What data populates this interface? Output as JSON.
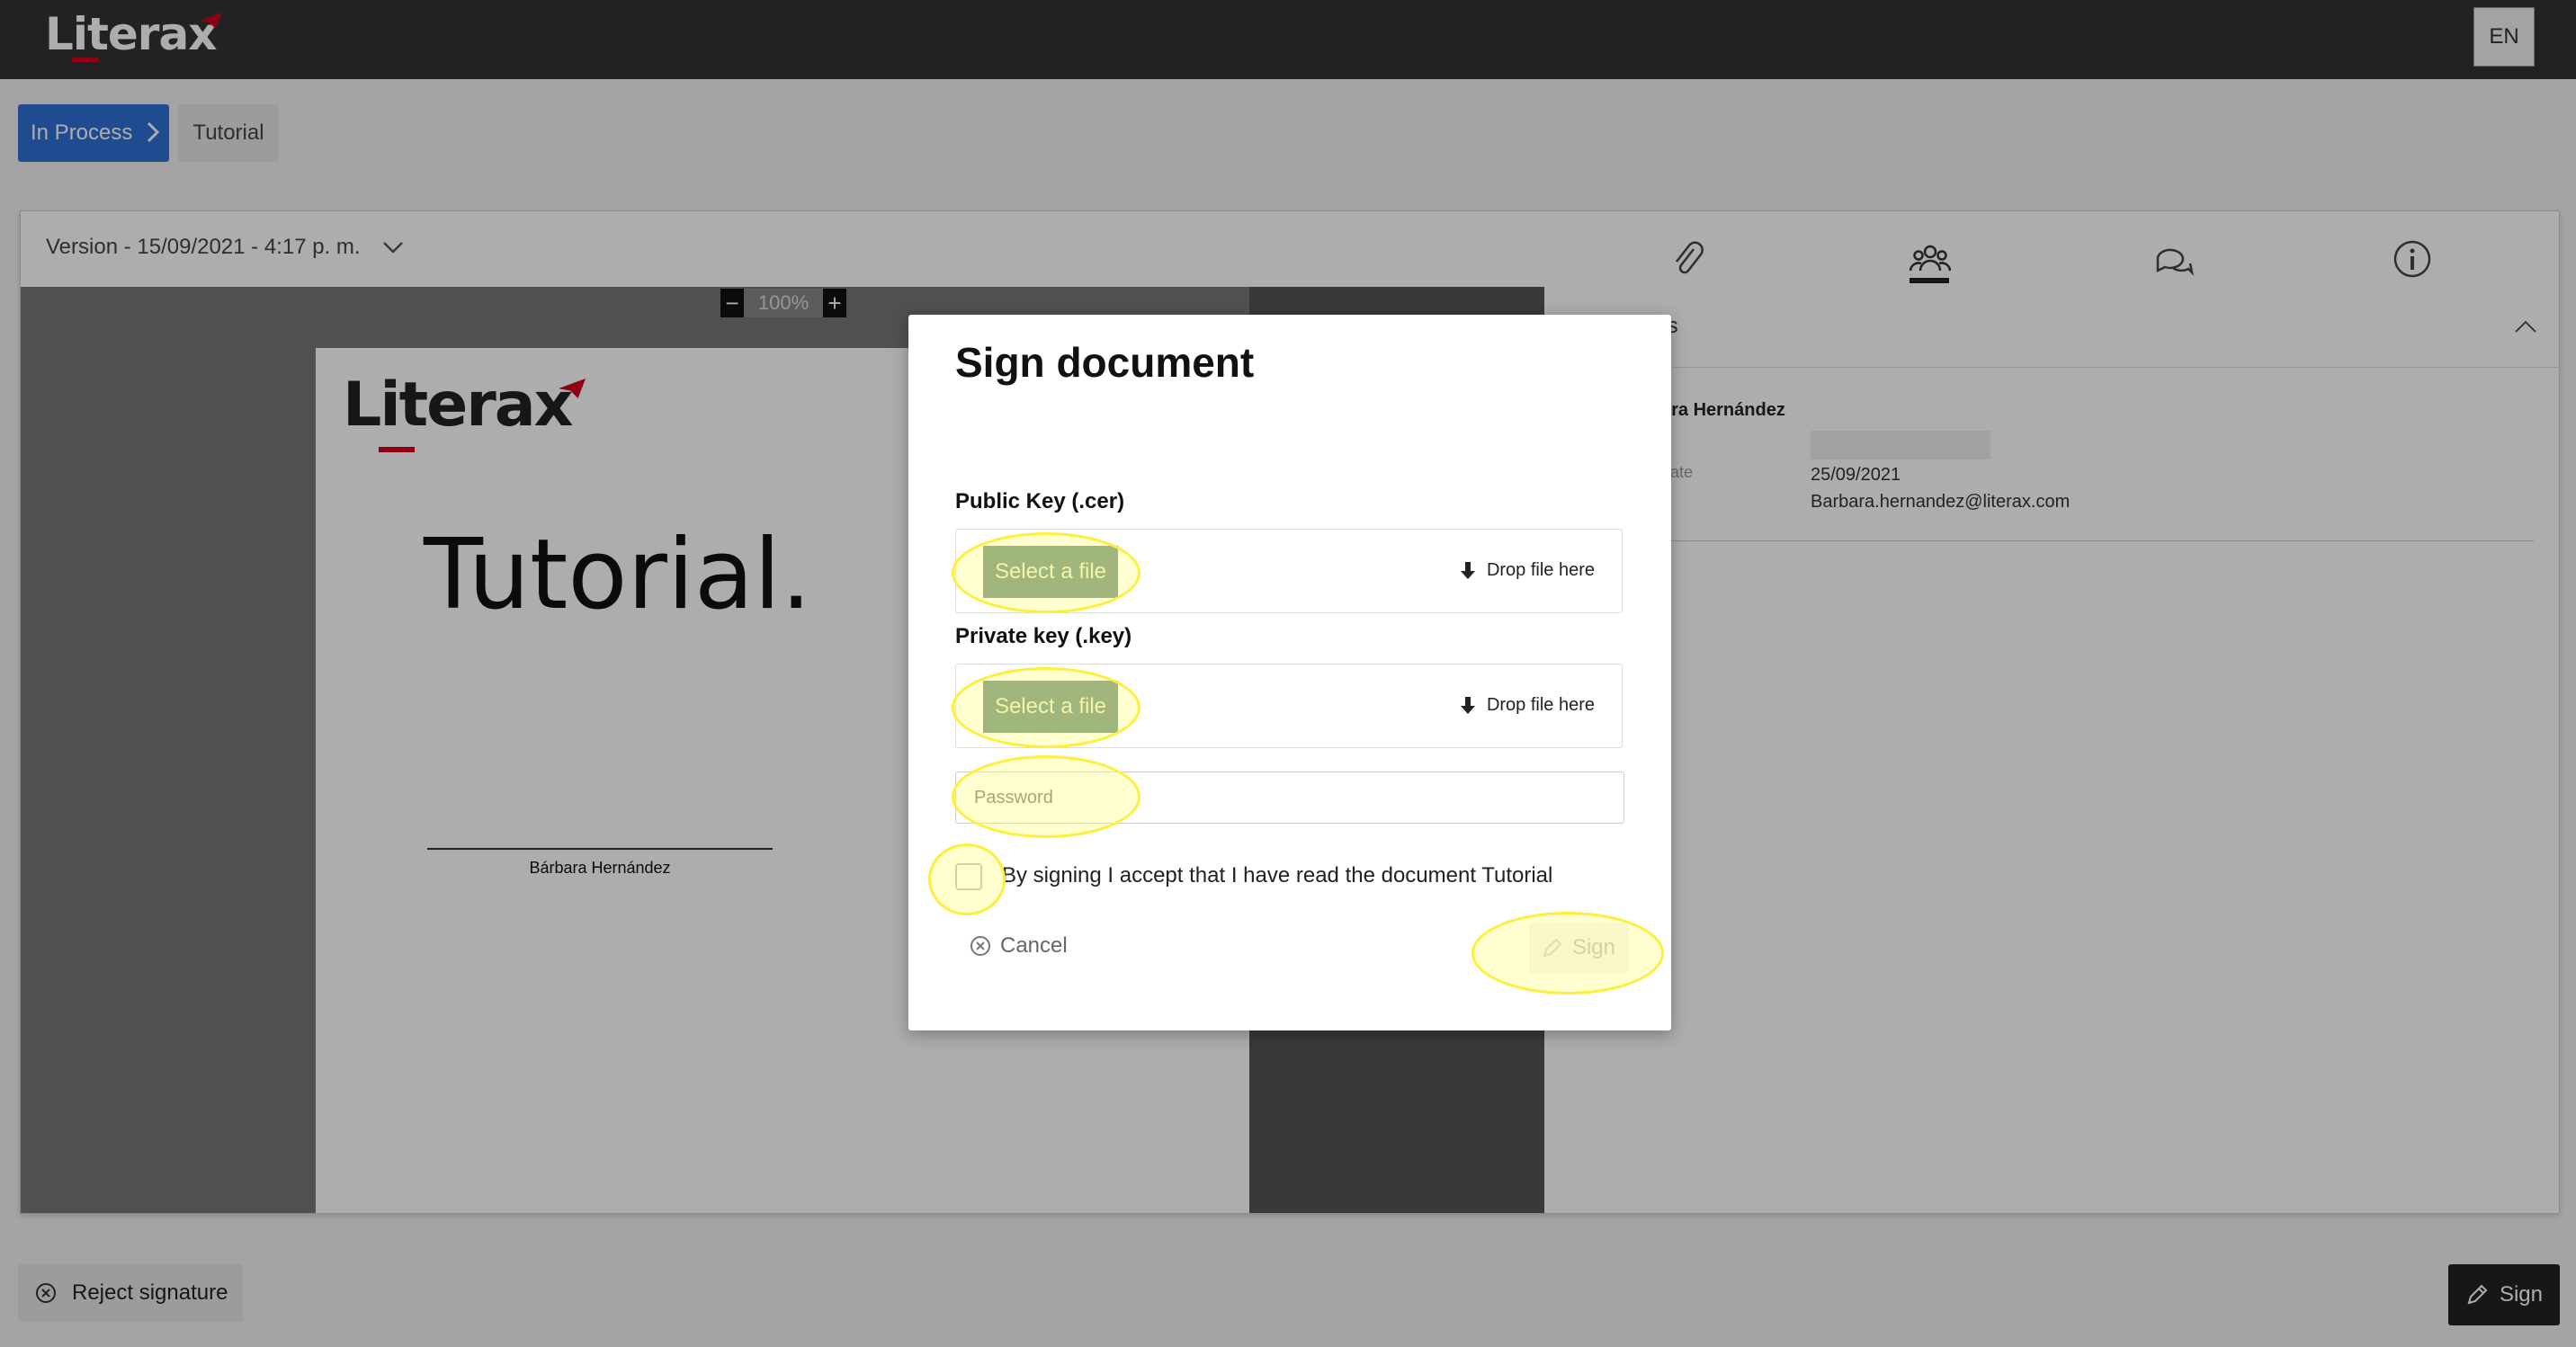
{
  "app": {
    "logo_text": "Literax",
    "language_button": "EN"
  },
  "breadcrumb": {
    "items": [
      {
        "label": "In Process"
      },
      {
        "label": "Tutorial"
      }
    ]
  },
  "toolbar": {
    "version_label": "Version - 15/09/2021 - 4:17 p. m.",
    "tab_icons": [
      "paperclip-icon",
      "participants-icon",
      "comments-icon",
      "info-icon"
    ],
    "active_tab": "participants-icon"
  },
  "viewer": {
    "zoom_minus": "−",
    "zoom_level": "100%",
    "zoom_plus": "+"
  },
  "document": {
    "logo_text": "Literax",
    "title": "Tutorial.",
    "signer_name": "Bárbara Hernández"
  },
  "side_panel": {
    "title_fragment": "ts",
    "signer_name_fragment": "ara Hernández",
    "date_label_fragment": "date",
    "date_value": "25/09/2021",
    "email": "Barbara.hernandez@literax.com"
  },
  "footer": {
    "reject_label": "Reject signature",
    "sign_label": "Sign"
  },
  "modal": {
    "title": "Sign document",
    "public_key": {
      "label": "Public Key (.cer)",
      "button": "Select a file",
      "drop_text": "Drop file here"
    },
    "private_key": {
      "label": "Private key (.key)",
      "button": "Select a file",
      "drop_text": "Drop file here"
    },
    "password": {
      "placeholder": "Password",
      "value": ""
    },
    "accept_checkbox": {
      "label": "By signing I accept that I have read the document Tutorial",
      "checked": false
    },
    "cancel_label": "Cancel",
    "sign_label": "Sign",
    "sign_enabled": false
  },
  "colors": {
    "topbar": "#333333",
    "brand_red": "#d0021b",
    "breadcrumb_active": "#2f6fd6",
    "select_file_button": "#6d8f80",
    "highlight": "#ffef3a"
  }
}
